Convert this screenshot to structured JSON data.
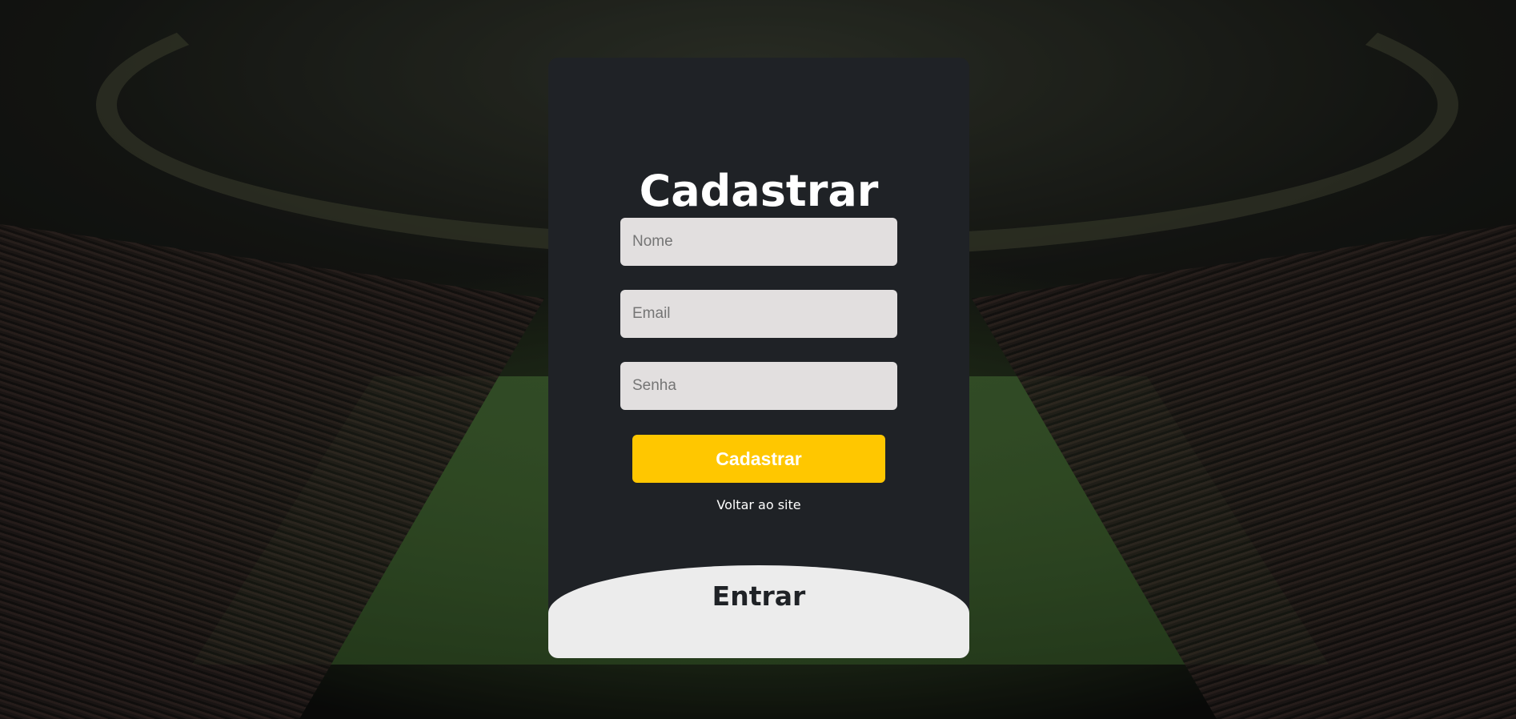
{
  "signup": {
    "title": "Cadastrar",
    "fields": {
      "name_placeholder": "Nome",
      "email_placeholder": "Email",
      "password_placeholder": "Senha"
    },
    "submit_label": "Cadastrar",
    "back_link": "Voltar ao site"
  },
  "login": {
    "label": "Entrar"
  },
  "colors": {
    "card_background": "#1f2226",
    "accent": "#ffc700",
    "field_background": "#e2dfdf",
    "login_panel": "#ececec"
  },
  "icons": {
    "background": "stadium-background-image"
  }
}
